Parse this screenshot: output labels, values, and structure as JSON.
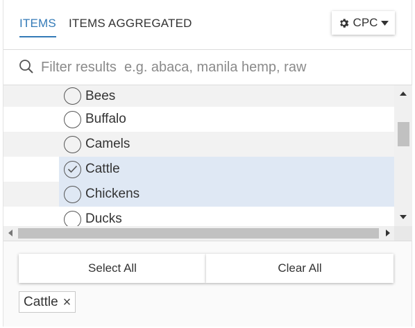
{
  "tabs": [
    {
      "label": "ITEMS",
      "active": true
    },
    {
      "label": "ITEMS AGGREGATED",
      "active": false
    }
  ],
  "cpc_button": {
    "label": "CPC",
    "icon": "gear-icon"
  },
  "search": {
    "placeholder": "Filter results  e.g. abaca, manila hemp, raw",
    "value": ""
  },
  "items": [
    {
      "label": "Bees",
      "selected": false
    },
    {
      "label": "Buffalo",
      "selected": false
    },
    {
      "label": "Camels",
      "selected": false
    },
    {
      "label": "Cattle",
      "selected": true
    },
    {
      "label": "Chickens",
      "selected": false
    },
    {
      "label": "Ducks",
      "selected": false
    }
  ],
  "actions": {
    "select_all": "Select All",
    "clear_all": "Clear All"
  },
  "selected_chips": [
    {
      "label": "Cattle"
    }
  ],
  "colors": {
    "accent": "#337ab7",
    "selected_row": "#dfe8f4",
    "stripe": "#f2f2f2"
  }
}
